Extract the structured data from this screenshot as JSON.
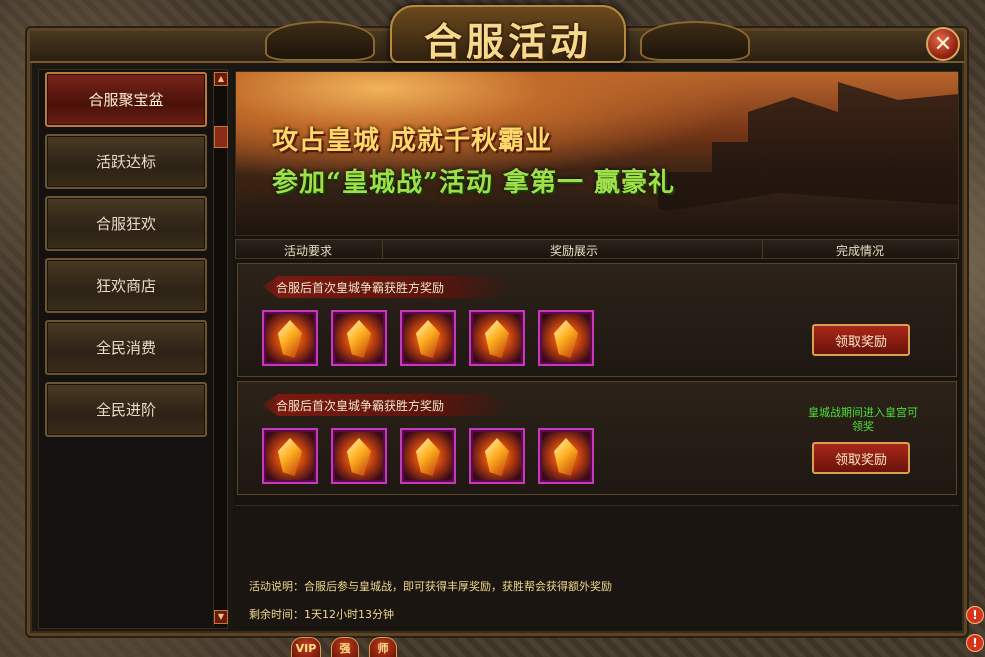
{
  "window": {
    "title": "合服活动",
    "close_glyph": "✕"
  },
  "sidebar": {
    "items": [
      {
        "label": "合服聚宝盆",
        "active": true
      },
      {
        "label": "活跃达标",
        "active": false
      },
      {
        "label": "合服狂欢",
        "active": false
      },
      {
        "label": "狂欢商店",
        "active": false
      },
      {
        "label": "全民消费",
        "active": false
      },
      {
        "label": "全民进阶",
        "active": false
      }
    ],
    "scroll_up": "▲",
    "scroll_down": "▼"
  },
  "banner": {
    "line1": "攻占皇城 成就千秋霸业",
    "line2": "参加“皇城战”活动 拿第一 赢豪礼"
  },
  "table_header": {
    "col1": "活动要求",
    "col2": "奖励展示",
    "col3": "完成情况"
  },
  "rewards": [
    {
      "requirement": "合服后首次皇城争霸获胜方奖励",
      "items": [
        "gem-item",
        "gem-item",
        "gem-item",
        "gem-item",
        "gem-item"
      ],
      "status_hint": "",
      "button": "领取奖励"
    },
    {
      "requirement": "合服后首次皇城争霸获胜方奖励",
      "items": [
        "gem-item",
        "gem-item",
        "gem-item",
        "gem-item",
        "gem-item"
      ],
      "status_hint": "皇城战期间进入皇宫可领奖",
      "button": "领取奖励"
    }
  ],
  "description": {
    "text": "活动说明：合服后参与皇城战，即可获得丰厚奖励，获胜帮会获得额外奖励",
    "remaining": "剩余时间：1天12小时13分钟"
  },
  "hud": {
    "vip": "VIP",
    "strong": "强",
    "master": "师",
    "alert": "!"
  },
  "colors": {
    "active_nav": "#7a2418",
    "item_border": "#c43ab8",
    "hint_green": "#4ae03a",
    "title_gold": "#f6d98a"
  }
}
